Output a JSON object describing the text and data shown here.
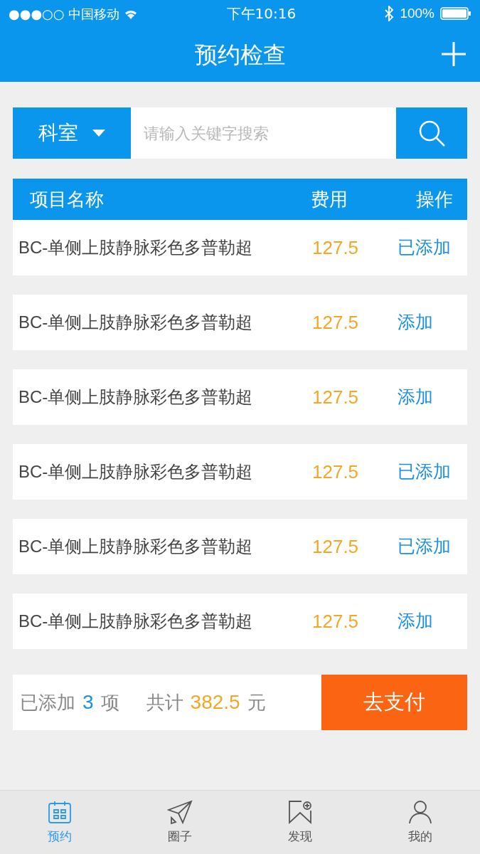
{
  "status_bar": {
    "carrier": "●●●○○ 中国移动",
    "time": "下午10:16",
    "battery": "100%"
  },
  "nav": {
    "title": "预约检查"
  },
  "search": {
    "department": "科室",
    "placeholder": "请输入关键字搜索"
  },
  "table": {
    "columns": [
      "项目名称",
      "费用",
      "操作"
    ],
    "rows": [
      {
        "name": "BC-单侧上肢静脉彩色多普勒超",
        "fee": "127.5",
        "action": "已添加"
      },
      {
        "name": "BC-单侧上肢静脉彩色多普勒超",
        "fee": "127.5",
        "action": "添加"
      },
      {
        "name": "BC-单侧上肢静脉彩色多普勒超",
        "fee": "127.5",
        "action": "添加"
      },
      {
        "name": "BC-单侧上肢静脉彩色多普勒超",
        "fee": "127.5",
        "action": "已添加"
      },
      {
        "name": "BC-单侧上肢静脉彩色多普勒超",
        "fee": "127.5",
        "action": "已添加"
      },
      {
        "name": "BC-单侧上肢静脉彩色多普勒超",
        "fee": "127.5",
        "action": "添加"
      }
    ]
  },
  "summary": {
    "added_label": "已添加",
    "count": "3",
    "unit": "项",
    "total_label": "共计",
    "total": "382.5",
    "currency": "元",
    "pay_button": "去支付"
  },
  "tab_bar": [
    {
      "label": "预约",
      "kind": "calendar",
      "selected": true
    },
    {
      "label": "圈子",
      "kind": "plane",
      "selected": false
    },
    {
      "label": "发现",
      "kind": "bookmark",
      "selected": false
    },
    {
      "label": "我的",
      "kind": "person",
      "selected": false
    }
  ]
}
